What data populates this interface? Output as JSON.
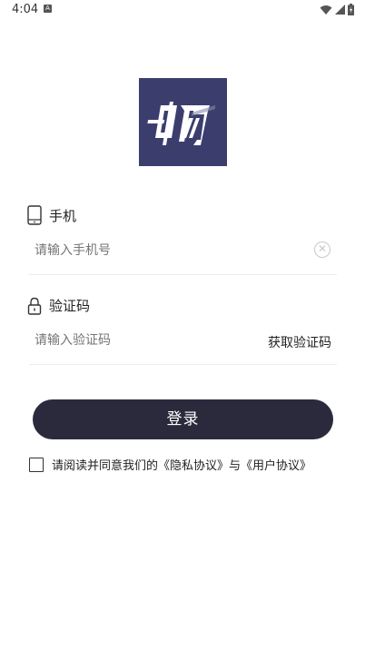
{
  "status_bar": {
    "time": "4:04",
    "notification_icon": "a-notification-icon",
    "icons": [
      "wifi-icon",
      "signal-icon",
      "battery-icon"
    ]
  },
  "logo": {
    "text": "畅",
    "color": "#3b3e6d"
  },
  "phone": {
    "label": "手机",
    "placeholder": "请输入手机号",
    "icon": "phone-icon",
    "clear_icon": "clear-icon"
  },
  "code": {
    "label": "验证码",
    "placeholder": "请输入验证码",
    "icon": "lock-icon",
    "get_code_label": "获取验证码"
  },
  "login": {
    "label": "登录",
    "color": "#2b2a3d"
  },
  "agreement": {
    "prefix": "请阅读并同意我们的",
    "privacy": "《隐私协议》",
    "joiner": "与",
    "user": "《用户协议》"
  }
}
